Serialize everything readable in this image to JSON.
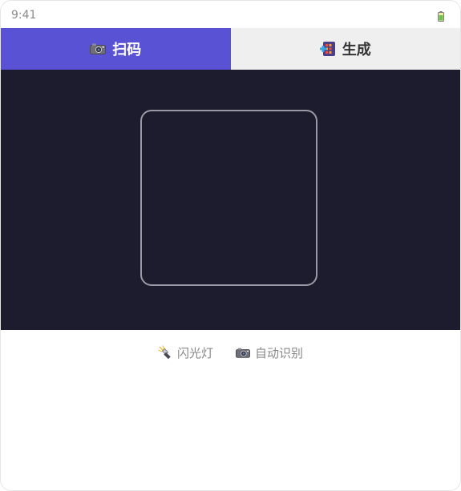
{
  "status_bar": {
    "time": "9:41",
    "battery_icon": "battery-icon"
  },
  "tabs": [
    {
      "label": "扫码",
      "icon": "camera-icon",
      "active": true
    },
    {
      "label": "生成",
      "icon": "grid-icon",
      "active": false
    }
  ],
  "controls": [
    {
      "label": "闪光灯",
      "icon": "flashlight-icon"
    },
    {
      "label": "自动识别",
      "icon": "camera-icon"
    }
  ],
  "colors": {
    "accent": "#5a52d5",
    "camera_background": "#1c1c2e",
    "inactive_tab": "#efefef",
    "scan_frame": "#9a9aa6"
  }
}
